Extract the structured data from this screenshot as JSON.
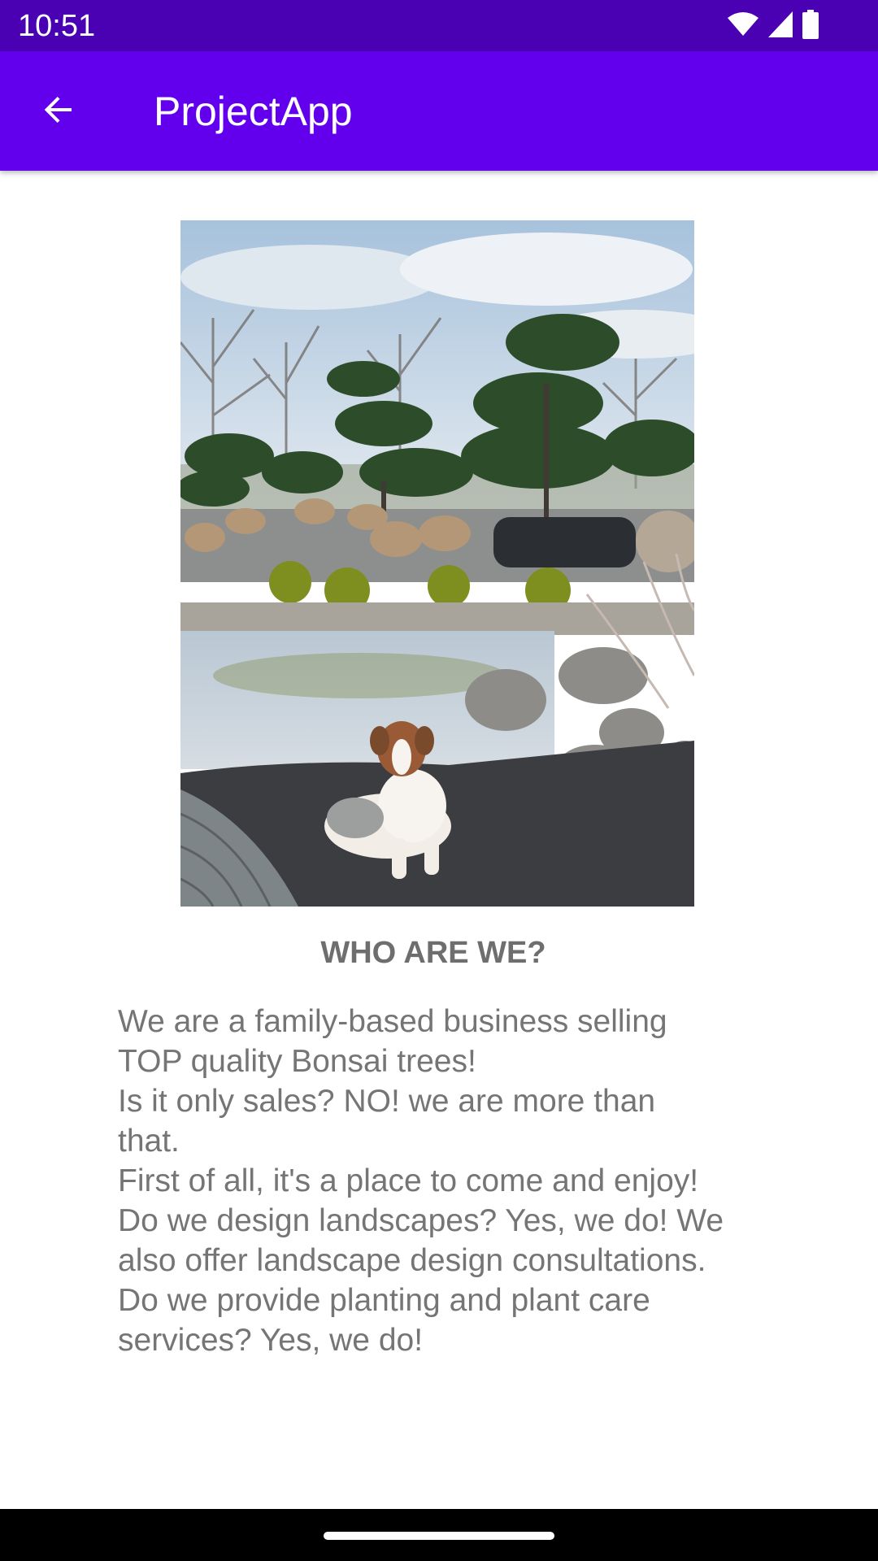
{
  "status_bar": {
    "time": "10:51",
    "icons": [
      "wifi-icon",
      "signal-icon",
      "battery-icon"
    ],
    "background": "#4a00b3"
  },
  "app_bar": {
    "title": "ProjectApp",
    "back_icon": "arrow-back-icon",
    "background": "#6200ee"
  },
  "content": {
    "image": "bonsai-garden-photo",
    "heading": "WHO ARE WE?",
    "body": " We are a family-based business selling\nTOP quality Bonsai trees!\n Is it only sales? NO! we are more than\nthat.\n First of all, it's a place to come and enjoy!\n Do we design landscapes? Yes, we do! We\nalso offer landscape design consultations.\n Do we provide planting and plant care\nservices? Yes, we do!"
  },
  "nav_bar": {
    "handle": "home-gesture-handle"
  }
}
